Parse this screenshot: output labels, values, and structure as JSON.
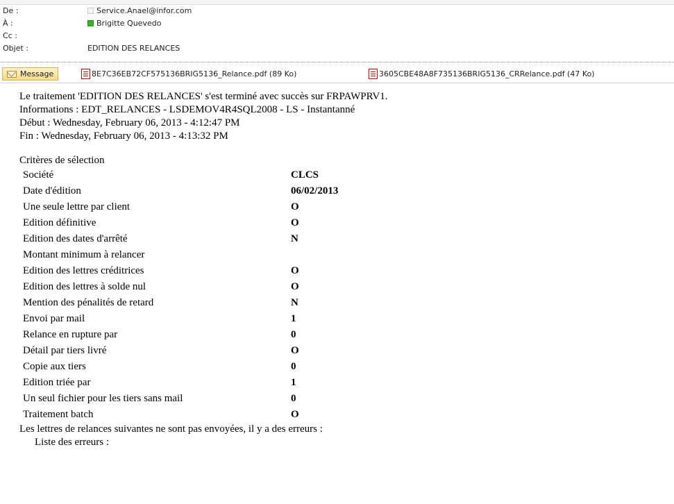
{
  "header": {
    "from_label": "De :",
    "from_value": "Service.Anael@infor.com",
    "to_label": "À :",
    "to_value": "Brigitte Quevedo",
    "cc_label": "Cc :",
    "cc_value": "",
    "subject_label": "Objet :",
    "subject_value": "EDITION DES RELANCES"
  },
  "attachments": {
    "message_tab": "Message",
    "files": [
      "8E7C36EB72CF575136BRIG5136_Relance.pdf (89 Ko)",
      "3605CBE48A8F735136BRIG5136_CRRelance.pdf (47 Ko)"
    ]
  },
  "body": {
    "intro": [
      "Le traitement 'EDITION DES RELANCES' s'est terminé avec succès sur FRPAWPRV1.",
      "Informations : EDT_RELANCES - LSDEMOV4R4SQL2008 - LS - Instantanné",
      "Début : Wednesday, February 06, 2013 - 4:12:47 PM",
      "Fin : Wednesday, February 06, 2013 - 4:13:32 PM"
    ],
    "criteria_title": "Critères de sélection",
    "criteria": [
      {
        "label": "Société",
        "value": "CLCS"
      },
      {
        "label": "Date d'édition",
        "value": "06/02/2013"
      },
      {
        "label": "Une seule lettre par client",
        "value": "O"
      },
      {
        "label": "Edition définitive",
        "value": "O"
      },
      {
        "label": "Edition des dates d'arrêté",
        "value": "N"
      },
      {
        "label": "Montant minimum à relancer",
        "value": ""
      },
      {
        "label": "Edition des lettres créditrices",
        "value": "O"
      },
      {
        "label": "Edition des lettres à solde nul",
        "value": "O"
      },
      {
        "label": "Mention des pénalités de retard",
        "value": "N"
      },
      {
        "label": "Envoi par mail",
        "value": "1"
      },
      {
        "label": "Relance en rupture par",
        "value": "0"
      },
      {
        "label": "Détail par tiers livré",
        "value": "O"
      },
      {
        "label": "Copie aux tiers",
        "value": "0"
      },
      {
        "label": "Edition triée par",
        "value": "1"
      },
      {
        "label": "Un seul fichier pour les tiers sans mail",
        "value": "0"
      },
      {
        "label": "Traitement batch",
        "value": "O"
      }
    ],
    "errors_line": "Les lettres de relances suivantes ne sont pas envoyées, il y a des erreurs :",
    "errors_list_label": "Liste des erreurs :"
  }
}
